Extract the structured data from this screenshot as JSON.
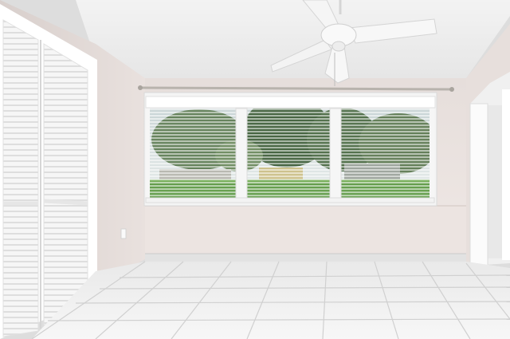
{
  "scene": {
    "palette": {
      "ceiling": "#ececec",
      "wall": "#ebe3e0",
      "wall_shadow": "#dcd3cf",
      "closet": "#f4f4f4",
      "floor_tile": "#f1f1f1",
      "grout": "#cfcfcf",
      "baseboard": "#d8d8d8",
      "window_frame": "#f2f2f2",
      "grass": "#5e9a45",
      "tree_dark": "#3f5f3a",
      "tree_mid": "#5f7d55",
      "sky": "#d9e3e6",
      "fan": "#f7f7f7"
    },
    "objects": [
      "ceiling-fan-icon",
      "louvered-closet-doors",
      "window-with-blinds",
      "curtain-rod",
      "wall-outlet-icon",
      "tile-floor",
      "doorway"
    ]
  }
}
